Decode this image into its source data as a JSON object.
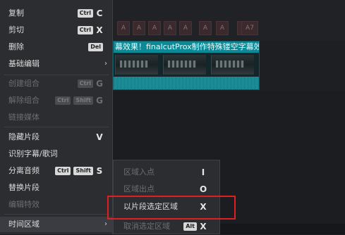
{
  "menu": {
    "items": [
      {
        "label": "复制",
        "keys": [
          "Ctrl"
        ],
        "letter": "C",
        "disabled": false
      },
      {
        "label": "剪切",
        "keys": [
          "Ctrl"
        ],
        "letter": "X",
        "disabled": false
      },
      {
        "label": "删除",
        "keys": [
          "Del"
        ],
        "letter": "",
        "disabled": false
      },
      {
        "label": "基础编辑",
        "submenu": true,
        "disabled": false
      },
      {
        "label": "创建组合",
        "keys": [
          "Ctrl"
        ],
        "letter": "G",
        "disabled": true
      },
      {
        "label": "解除组合",
        "keys": [
          "Ctrl",
          "Shift"
        ],
        "letter": "G",
        "disabled": true
      },
      {
        "label": "链接媒体",
        "disabled": true
      },
      {
        "label": "隐藏片段",
        "letter": "V",
        "disabled": false
      },
      {
        "label": "识别字幕/歌词",
        "disabled": false
      },
      {
        "label": "分离音频",
        "keys": [
          "Ctrl",
          "Shift"
        ],
        "letter": "S",
        "disabled": false
      },
      {
        "label": "替换片段",
        "disabled": false
      },
      {
        "label": "编辑特效",
        "disabled": true
      },
      {
        "label": "时间区域",
        "submenu": true,
        "disabled": false
      }
    ]
  },
  "submenu": {
    "items": [
      {
        "label": "区域入点",
        "letter": "I",
        "disabled": true
      },
      {
        "label": "区域出点",
        "letter": "O",
        "disabled": true
      },
      {
        "label": "以片段选定区域",
        "letter": "X",
        "disabled": false
      },
      {
        "label": "取消选定区域",
        "keys": [
          "Alt"
        ],
        "letter": "X",
        "disabled": true
      }
    ]
  },
  "timeline": {
    "clip_title": "幕效果！finalcutProx制作特殊镂空字幕效果：",
    "markers": [
      "A",
      "A",
      "A",
      "A",
      "A",
      "A",
      "A",
      "A",
      "A",
      "A7"
    ]
  },
  "colors": {
    "highlight": "#e02020",
    "clip": "#0e6e78"
  }
}
